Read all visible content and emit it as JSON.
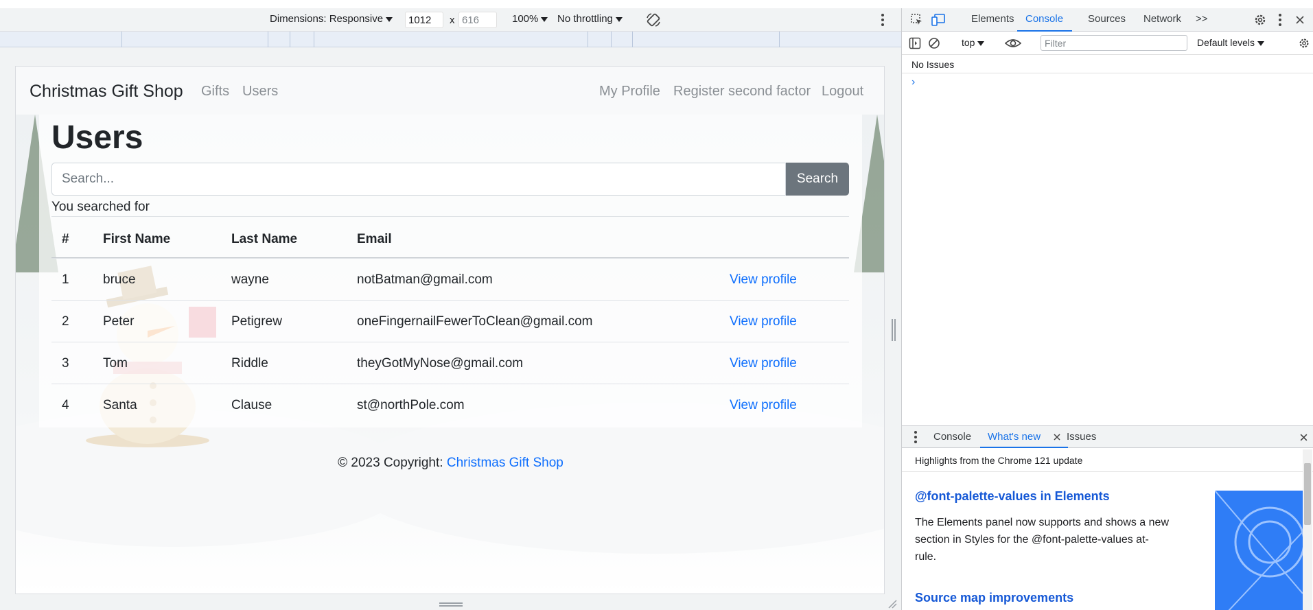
{
  "device_toolbar": {
    "dimensions_label": "Dimensions: Responsive",
    "width_value": "1012",
    "height_value": "616",
    "times_sign": "x",
    "zoom": "100%",
    "throttling": "No throttling"
  },
  "site": {
    "brand": "Christmas Gift Shop",
    "nav_left": [
      "Gifts",
      "Users"
    ],
    "nav_right": [
      "My Profile",
      "Register second factor",
      "Logout"
    ],
    "page_title": "Users",
    "search_placeholder": "Search...",
    "search_button": "Search",
    "searched_for": "You searched for",
    "table": {
      "headers": [
        "#",
        "First Name",
        "Last Name",
        "Email"
      ],
      "rows": [
        {
          "num": "1",
          "first": "bruce",
          "last": "wayne",
          "email": "notBatman@gmail.com",
          "action": "View profile"
        },
        {
          "num": "2",
          "first": "Peter",
          "last": "Petigrew",
          "email": "oneFingernailFewerToClean@gmail.com",
          "action": "View profile"
        },
        {
          "num": "3",
          "first": "Tom",
          "last": "Riddle",
          "email": "theyGotMyNose@gmail.com",
          "action": "View profile"
        },
        {
          "num": "4",
          "first": "Santa",
          "last": "Clause",
          "email": "st@northPole.com",
          "action": "View profile"
        }
      ]
    },
    "footer_text": "© 2023 Copyright: ",
    "footer_link": "Christmas Gift Shop"
  },
  "devtools": {
    "tabs": [
      "Elements",
      "Console",
      "Sources",
      "Network"
    ],
    "more_tabs": ">>",
    "active_tab": "Console",
    "context": "top",
    "filter_placeholder": "Filter",
    "levels": "Default levels",
    "no_issues": "No Issues",
    "prompt": "›",
    "drawer_tabs": [
      "Console",
      "What's new",
      "Issues"
    ],
    "drawer_active": "What's new",
    "highlights": "Highlights from the Chrome 121 update",
    "feature1_title": "@font-palette-values in Elements",
    "feature1_text": "The Elements panel now supports and shows a new section in Styles for the @font-palette-values at-rule.",
    "feature2_title": "Source map improvements"
  },
  "colors": {
    "link": "#0d6efd",
    "devtools_accent": "#1a73e8",
    "search_button": "#6c757d"
  }
}
